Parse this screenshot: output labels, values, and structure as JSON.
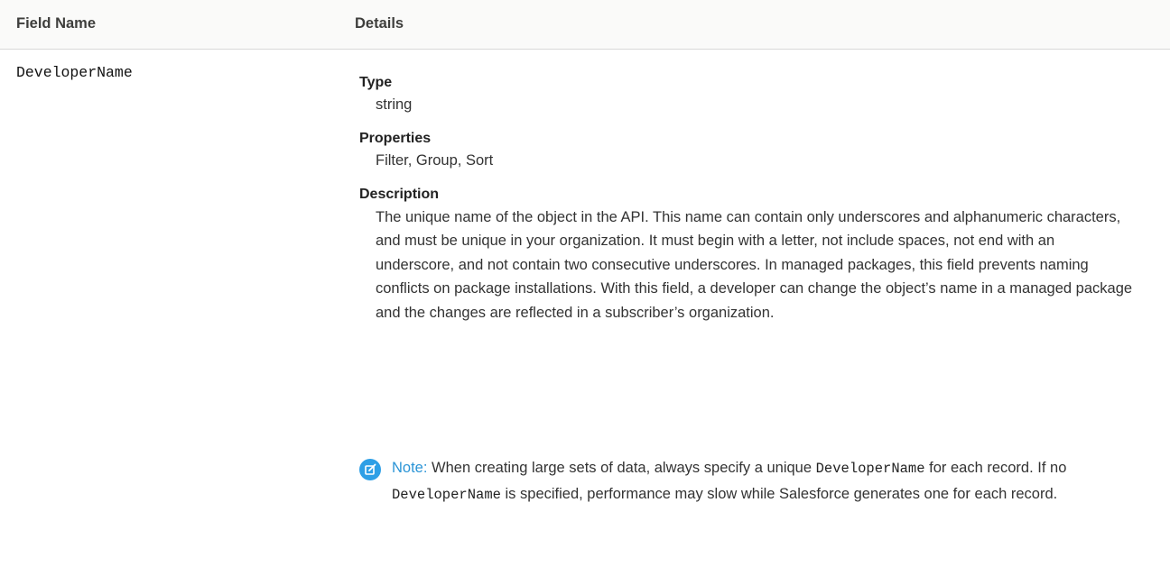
{
  "table": {
    "headers": {
      "field_name": "Field Name",
      "details": "Details"
    },
    "row": {
      "field_name": "DeveloperName",
      "type_label": "Type",
      "type_value": "string",
      "properties_label": "Properties",
      "properties_value": "Filter, Group, Sort",
      "description_label": "Description",
      "description_value": "The unique name of the object in the API. This name can contain only underscores and alphanumeric characters, and must be unique in your organization. It must begin with a letter, not include spaces, not end with an underscore, and not contain two consecutive underscores. In managed packages, this field prevents naming conflicts on package installations. With this field, a developer can change the object’s name in a managed package and the changes are reflected in a subscriber’s organization.",
      "note": {
        "icon": "edit-note-icon",
        "icon_color": "#2e9fe6",
        "label": "Note:",
        "text_1": "When creating large sets of data, always specify a unique",
        "code_1": "DeveloperName",
        "text_2": "for each record. If no",
        "code_2": "DeveloperName",
        "text_3": "is specified, performance may slow while Salesforce generates one for each record."
      }
    }
  }
}
